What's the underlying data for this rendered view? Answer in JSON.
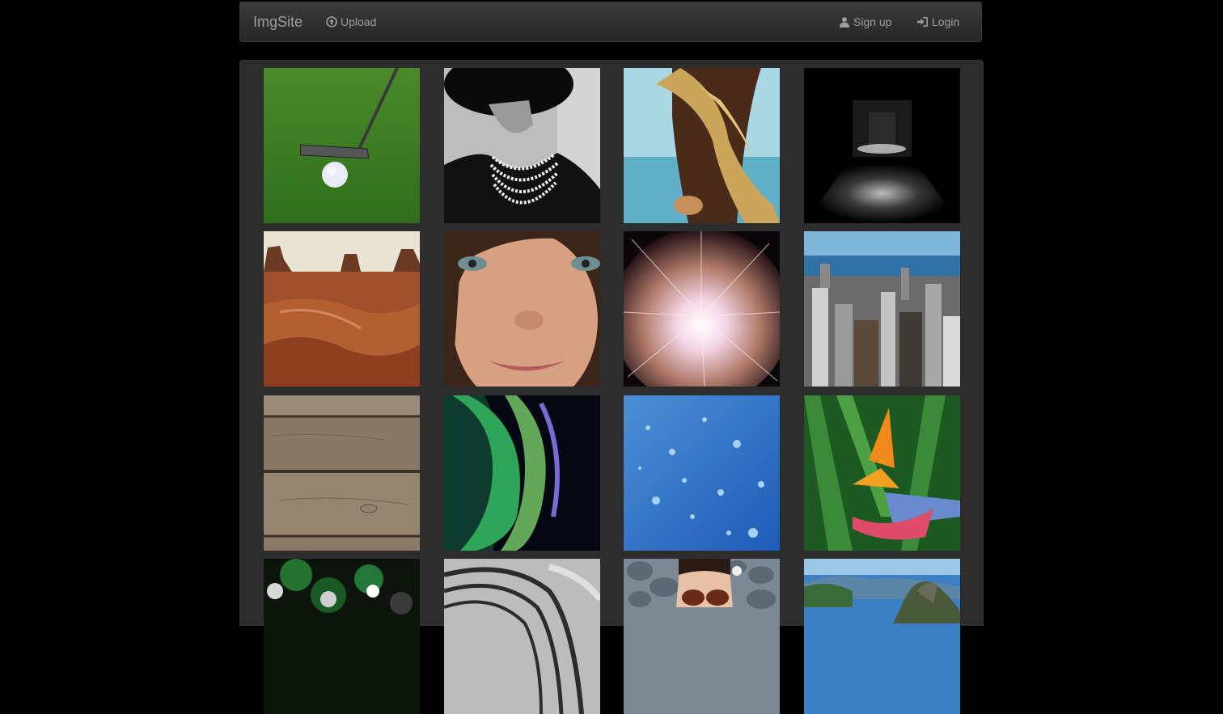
{
  "navbar": {
    "brand": "ImgSite",
    "upload_label": "Upload",
    "signup_label": "Sign up",
    "login_label": "Login",
    "upload_icon": "circle-arrow-up-icon",
    "signup_icon": "user-icon",
    "login_icon": "login-icon"
  },
  "gallery": {
    "items": [
      {
        "subject": "golf-putter-and-ball"
      },
      {
        "subject": "woman-hat-pearls-bw"
      },
      {
        "subject": "horse-blond-mane"
      },
      {
        "subject": "dark-corridor"
      },
      {
        "subject": "desert-buttes"
      },
      {
        "subject": "freckled-girl-face"
      },
      {
        "subject": "firework-burst"
      },
      {
        "subject": "city-skyline-aerial"
      },
      {
        "subject": "wooden-planks"
      },
      {
        "subject": "aurora-borealis"
      },
      {
        "subject": "water-droplets-blue"
      },
      {
        "subject": "bird-of-paradise-flower"
      },
      {
        "subject": "green-bokeh-lights"
      },
      {
        "subject": "curved-stairs-bw"
      },
      {
        "subject": "woman-sunglasses-pebbles"
      },
      {
        "subject": "sugarloaf-mountain-bay"
      }
    ]
  },
  "colors": {
    "page_background": "#000000",
    "navbar_background": "#2e2e2e",
    "panel_background": "#2d2d2d",
    "nav_text": "#9d9d9d"
  }
}
